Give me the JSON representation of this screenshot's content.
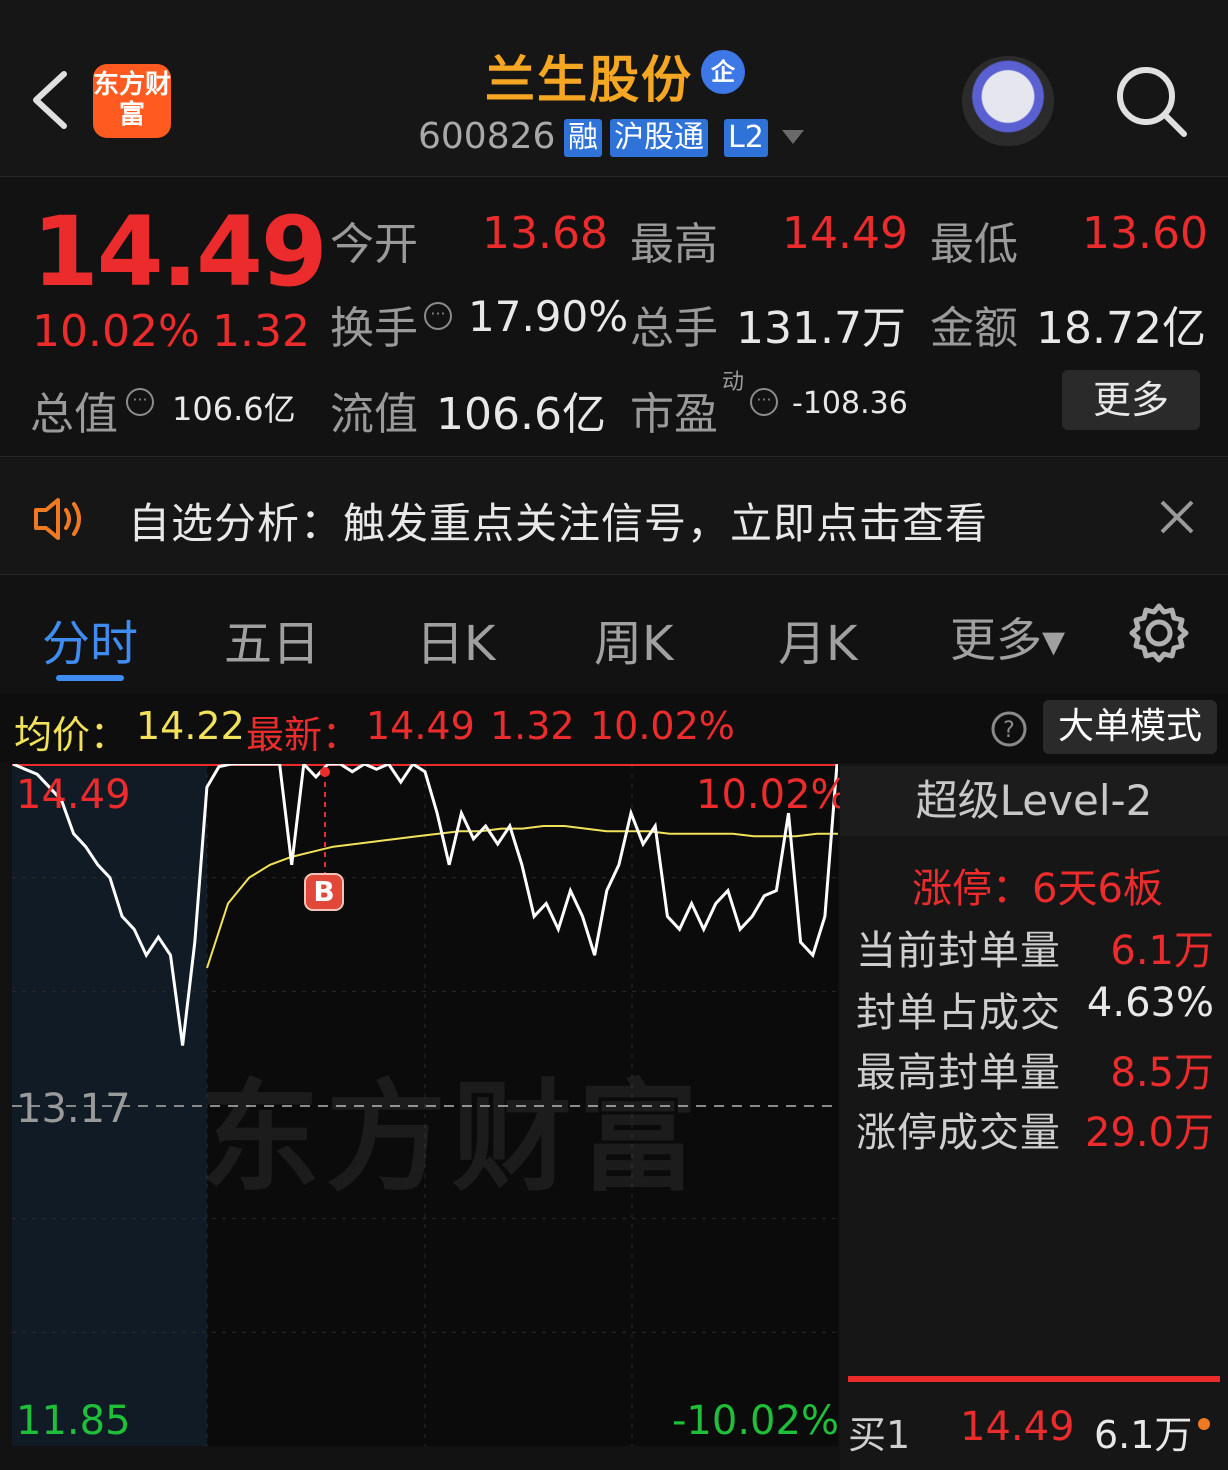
{
  "header": {
    "logo_text": "东方财富",
    "title": "兰生股份",
    "qi_badge": "企",
    "code": "600826",
    "tags": [
      "融",
      "沪股通",
      "L2"
    ]
  },
  "quote": {
    "price": "14.49",
    "change_pct": "10.02%",
    "change": "1.32",
    "open_label": "今开",
    "open": "13.68",
    "high_label": "最高",
    "high": "14.49",
    "low_label": "最低",
    "low": "13.60",
    "turnover_label": "换手",
    "turnover": "17.90%",
    "volume_label": "总手",
    "volume": "131.7万",
    "amount_label": "金额",
    "amount": "18.72亿",
    "total_mv_label": "总值",
    "total_mv": "106.6亿",
    "float_mv_label": "流值",
    "float_mv": "106.6亿",
    "pe_label": "市盈",
    "pe_sup": "动",
    "pe": "-108.36",
    "more_label": "更多"
  },
  "alert": {
    "text": "自选分析：触发重点关注信号，立即点击查看"
  },
  "tabs": [
    {
      "label": "分时",
      "active": true
    },
    {
      "label": "五日"
    },
    {
      "label": "日K"
    },
    {
      "label": "周K"
    },
    {
      "label": "月K"
    },
    {
      "label": "更多▾"
    }
  ],
  "infobar": {
    "avg_label": "均价：",
    "avg": "14.22",
    "latest_label": "最新：",
    "latest": "14.49",
    "latest_change": "1.32",
    "latest_pct": "10.02%",
    "big_order_label": "大单模式"
  },
  "chart": {
    "y_top": "14.49",
    "y_mid": "13.17",
    "y_bottom": "11.85",
    "pct_top": "10.02%",
    "pct_bottom": "-10.02%",
    "watermark": "东方财富",
    "b_marker": "B",
    "price_series": [
      14.49,
      14.47,
      14.45,
      14.4,
      14.35,
      14.22,
      14.17,
      14.1,
      14.05,
      13.9,
      13.85,
      13.75,
      13.82,
      13.75,
      13.4,
      13.8,
      14.4,
      14.48,
      14.49,
      14.49,
      14.49,
      14.49,
      14.49,
      14.1,
      14.49,
      14.44,
      14.49,
      14.49,
      14.46,
      14.49,
      14.47,
      14.49,
      14.42,
      14.49,
      14.46,
      14.3,
      14.1,
      14.3,
      14.2,
      14.25,
      14.18,
      14.25,
      14.1,
      13.9,
      13.95,
      13.85,
      14.0,
      13.9,
      13.75,
      14.0,
      14.1,
      14.3,
      14.18,
      14.25,
      13.9,
      13.85,
      13.95,
      13.85,
      13.95,
      14.0,
      13.85,
      13.9,
      13.98,
      14.0,
      14.3,
      13.8,
      13.75,
      13.9,
      14.49
    ],
    "avg_series": [
      13.7,
      13.95,
      14.05,
      14.1,
      14.13,
      14.15,
      14.17,
      14.18,
      14.19,
      14.2,
      14.21,
      14.22,
      14.23,
      14.23,
      14.24,
      14.24,
      14.25,
      14.25,
      14.24,
      14.23,
      14.23,
      14.23,
      14.22,
      14.22,
      14.22,
      14.22,
      14.21,
      14.21,
      14.21,
      14.22,
      14.22
    ]
  },
  "level2": {
    "title": "超级Level-2",
    "limit_label": "涨停：6天6板",
    "rows": [
      {
        "label": "当前封单量",
        "value": "6.1万",
        "color": "#ec2c2c"
      },
      {
        "label": "封单占成交",
        "value": "4.63%",
        "color": "#e8e8e8"
      },
      {
        "label": "最高封单量",
        "value": "8.5万",
        "color": "#ec2c2c"
      },
      {
        "label": "涨停成交量",
        "value": "29.0万",
        "color": "#ec2c2c"
      }
    ],
    "buy1_label": "买1",
    "buy1_price": "14.49",
    "buy1_vol": "6.1万"
  }
}
